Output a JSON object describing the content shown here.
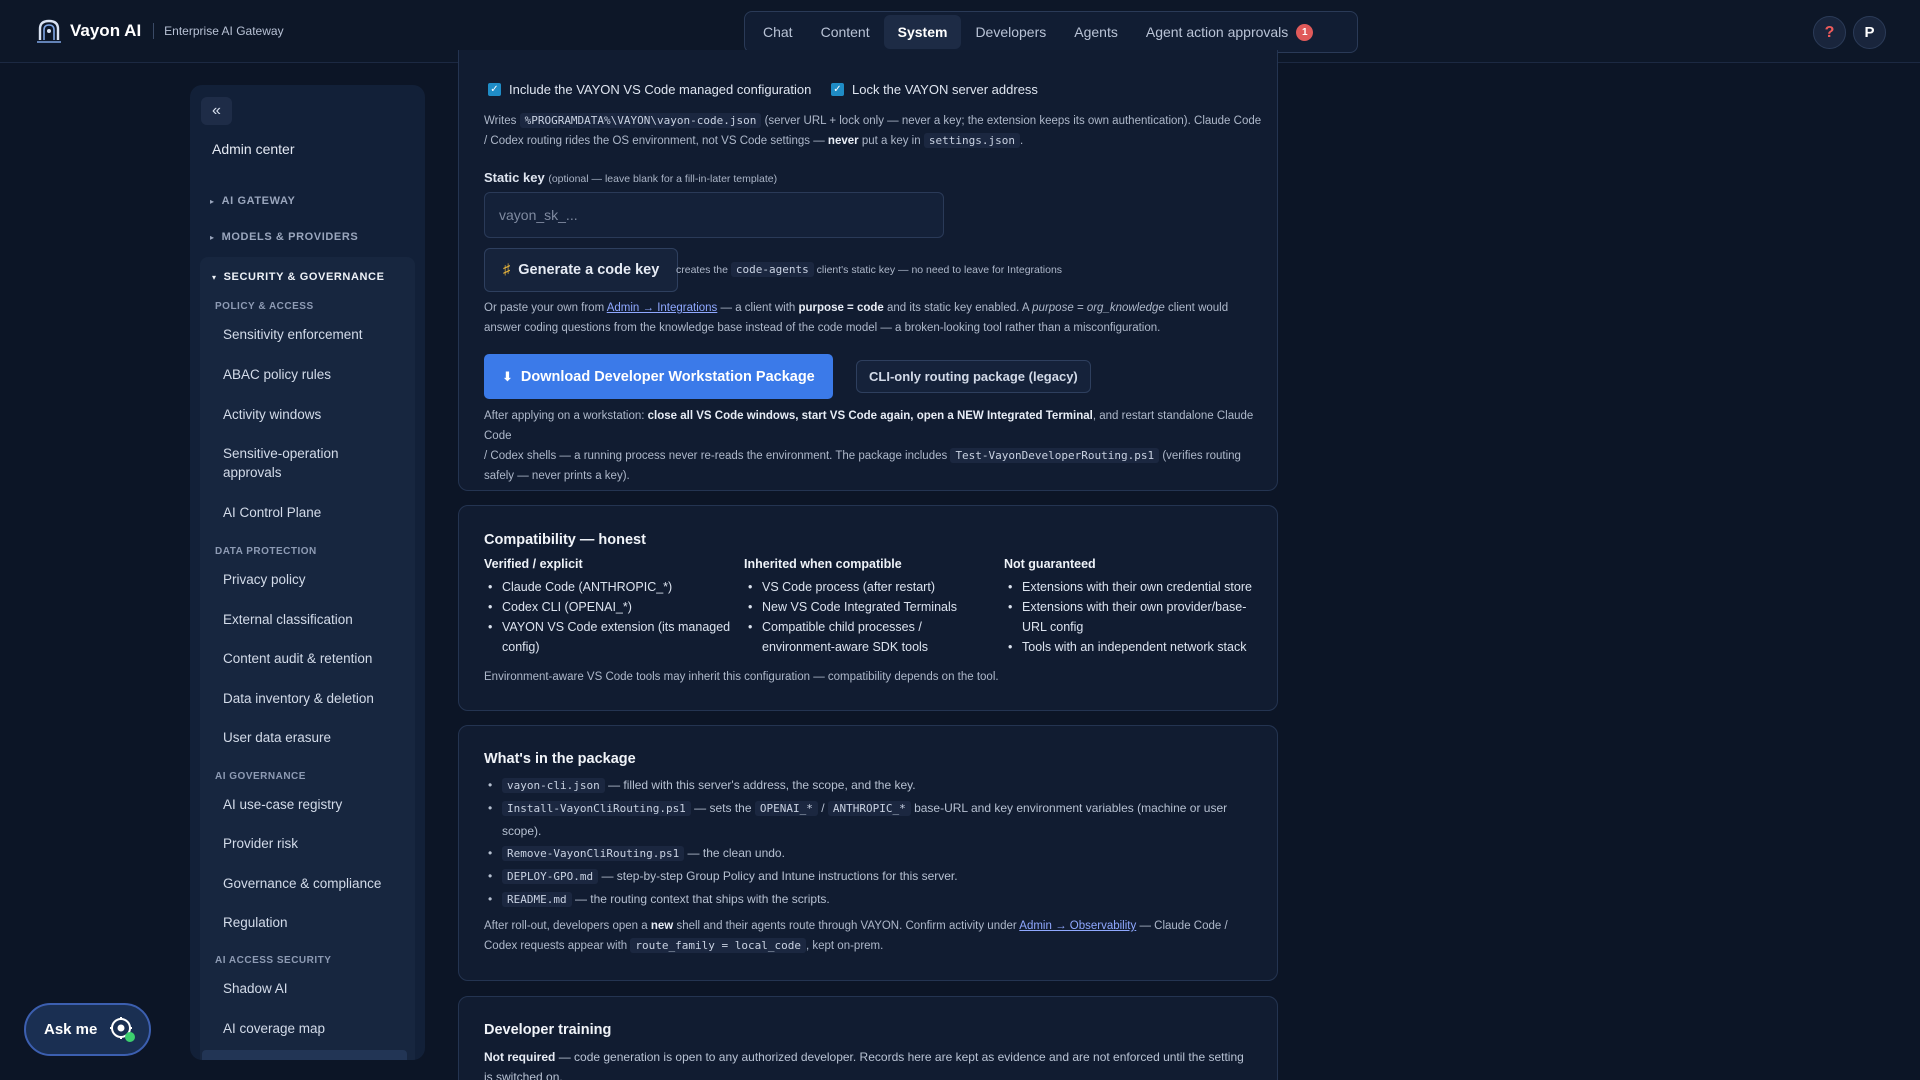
{
  "brand": {
    "name": "Vayon AI",
    "subtitle": "Enterprise AI Gateway"
  },
  "nav": {
    "items": [
      "Chat",
      "Content",
      "System",
      "Developers",
      "Agents",
      "Agent action approvals"
    ],
    "active": "System",
    "badge": "1"
  },
  "topright": {
    "help": "?",
    "avatar": "P"
  },
  "sidebar": {
    "collapse": "«",
    "admin_center": "Admin center",
    "sections": [
      "AI GATEWAY",
      "MODELS & PROVIDERS",
      "SECURITY & GOVERNANCE"
    ],
    "groups": {
      "policy": "POLICY & ACCESS",
      "data": "DATA PROTECTION",
      "ai_gov": "AI GOVERNANCE",
      "ai_sec": "AI ACCESS SECURITY"
    },
    "items": {
      "sensitivity": "Sensitivity enforcement",
      "abac": "ABAC policy rules",
      "activity": "Activity windows",
      "sensitive_op": "Sensitive-operation approvals",
      "control_plane": "AI Control Plane",
      "privacy": "Privacy policy",
      "ext_class": "External classification",
      "audit": "Content audit & retention",
      "inventory": "Data inventory & deletion",
      "erasure": "User data erasure",
      "usecase": "AI use-case registry",
      "provider_risk": "Provider risk",
      "gov_compliance": "Governance & compliance",
      "regulation": "Regulation",
      "shadow": "Shadow AI",
      "coverage": "AI coverage map"
    }
  },
  "ask_me": "Ask me",
  "card1": {
    "chk1": "Include the VAYON VS Code managed configuration",
    "chk2": "Lock the VAYON server address",
    "writes": {
      "a": "Writes",
      "path": "%PROGRAMDATA%\\VAYON\\vayon-code.json",
      "b": "(server URL + lock only — never a key; the extension keeps its own authentication). Claude Code",
      "c": "/ Codex routing rides the OS environment, not VS Code settings —",
      "never": "never",
      "d": "put a key in",
      "settings": "settings.json",
      "e": "."
    },
    "static_key_label": "Static key",
    "static_key_opt": "(optional — leave blank for a fill-in-later template)",
    "placeholder": "vayon_sk_...",
    "gen_btn": "Generate a code key",
    "gen_note_a": "creates the",
    "gen_note_code": "code-agents",
    "gen_note_b": "client's static key — no need to leave for Integrations",
    "paste": {
      "a": "Or paste your own from",
      "link": "Admin → Integrations",
      "b": "— a client with",
      "purpose": "purpose = code",
      "c": "and its static key enabled. A",
      "purpose2": "purpose = org_knowledge",
      "d": "client would",
      "e": "answer coding questions from the knowledge base instead of the code model — a broken-looking tool rather than a misconfiguration."
    },
    "download_btn": "Download Developer Workstation Package",
    "legacy_btn": "CLI-only routing package (legacy)",
    "after": {
      "a": "After applying on a workstation:",
      "bold": "close all VS Code windows, start VS Code again, open a NEW Integrated Terminal",
      "b": ", and restart standalone Claude Code",
      "c": "/ Codex shells — a running process never re-reads the environment. The package includes",
      "code": "Test-VayonDeveloperRouting.ps1",
      "d": "(verifies routing",
      "e": "safely — never prints a key)."
    }
  },
  "card2": {
    "title": "Compatibility — honest",
    "columns": [
      {
        "head": "Verified / explicit",
        "items": [
          "Claude Code (ANTHROPIC_*)",
          "Codex CLI (OPENAI_*)",
          "VAYON VS Code extension (its managed config)"
        ]
      },
      {
        "head": "Inherited when compatible",
        "items": [
          "VS Code process (after restart)",
          "New VS Code Integrated Terminals",
          "Compatible child processes / environment-aware SDK tools"
        ]
      },
      {
        "head": "Not guaranteed",
        "items": [
          "Extensions with their own credential store",
          "Extensions with their own provider/base-URL config",
          "Tools with an independent network stack"
        ]
      }
    ],
    "note": "Environment-aware VS Code tools may inherit this configuration — compatibility depends on the tool."
  },
  "card3": {
    "title": "What's in the package",
    "items": [
      {
        "code": "vayon-cli.json",
        "text": "— filled with this server's address, the scope, and the key."
      },
      {
        "code": "Install-VayonCliRouting.ps1",
        "text": "— sets the",
        "code2": "OPENAI_*",
        "sep": "/",
        "code3": "ANTHROPIC_*",
        "text2": "base-URL and key environment variables (machine or user",
        "text3": "scope)."
      },
      {
        "code": "Remove-VayonCliRouting.ps1",
        "text": "— the clean undo."
      },
      {
        "code": "DEPLOY-GPO.md",
        "text": "— step-by-step Group Policy and Intune instructions for this server."
      },
      {
        "code": "README.md",
        "text": "— the routing context that ships with the scripts."
      }
    ],
    "after": {
      "a": "After roll-out, developers open a",
      "new": "new",
      "b": "shell and their agents route through VAYON. Confirm activity under",
      "link": "Admin → Observability",
      "c": "— Claude Code /",
      "d": "Codex requests appear with",
      "code": "route_family = local_code",
      "e": ", kept on-prem."
    }
  },
  "card4": {
    "title": "Developer training",
    "bold": "Not required",
    "text": "— code generation is open to any authorized developer. Records here are kept as evidence and are not enforced until the setting",
    "text2": "is switched on."
  }
}
